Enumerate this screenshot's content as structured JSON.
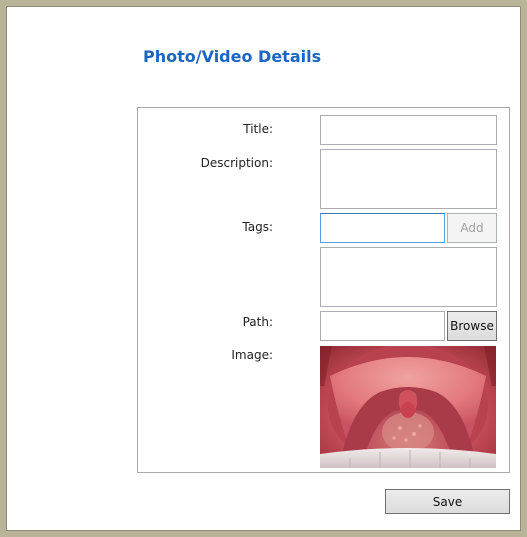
{
  "page_title": "Photo/Video Details",
  "fields": {
    "title_label": "Title:",
    "title_value": "",
    "description_label": "Description:",
    "description_value": "",
    "tags_label": "Tags:",
    "tags_value": "",
    "tags_list": "",
    "path_label": "Path:",
    "path_value": "",
    "image_label": "Image:"
  },
  "buttons": {
    "add_label": "Add",
    "browse_label": "Browse",
    "save_label": "Save"
  },
  "image": {
    "subject": "mouth-throat-photo"
  },
  "colors": {
    "title": "#1b66c0",
    "window_border": "#b9b39a"
  }
}
